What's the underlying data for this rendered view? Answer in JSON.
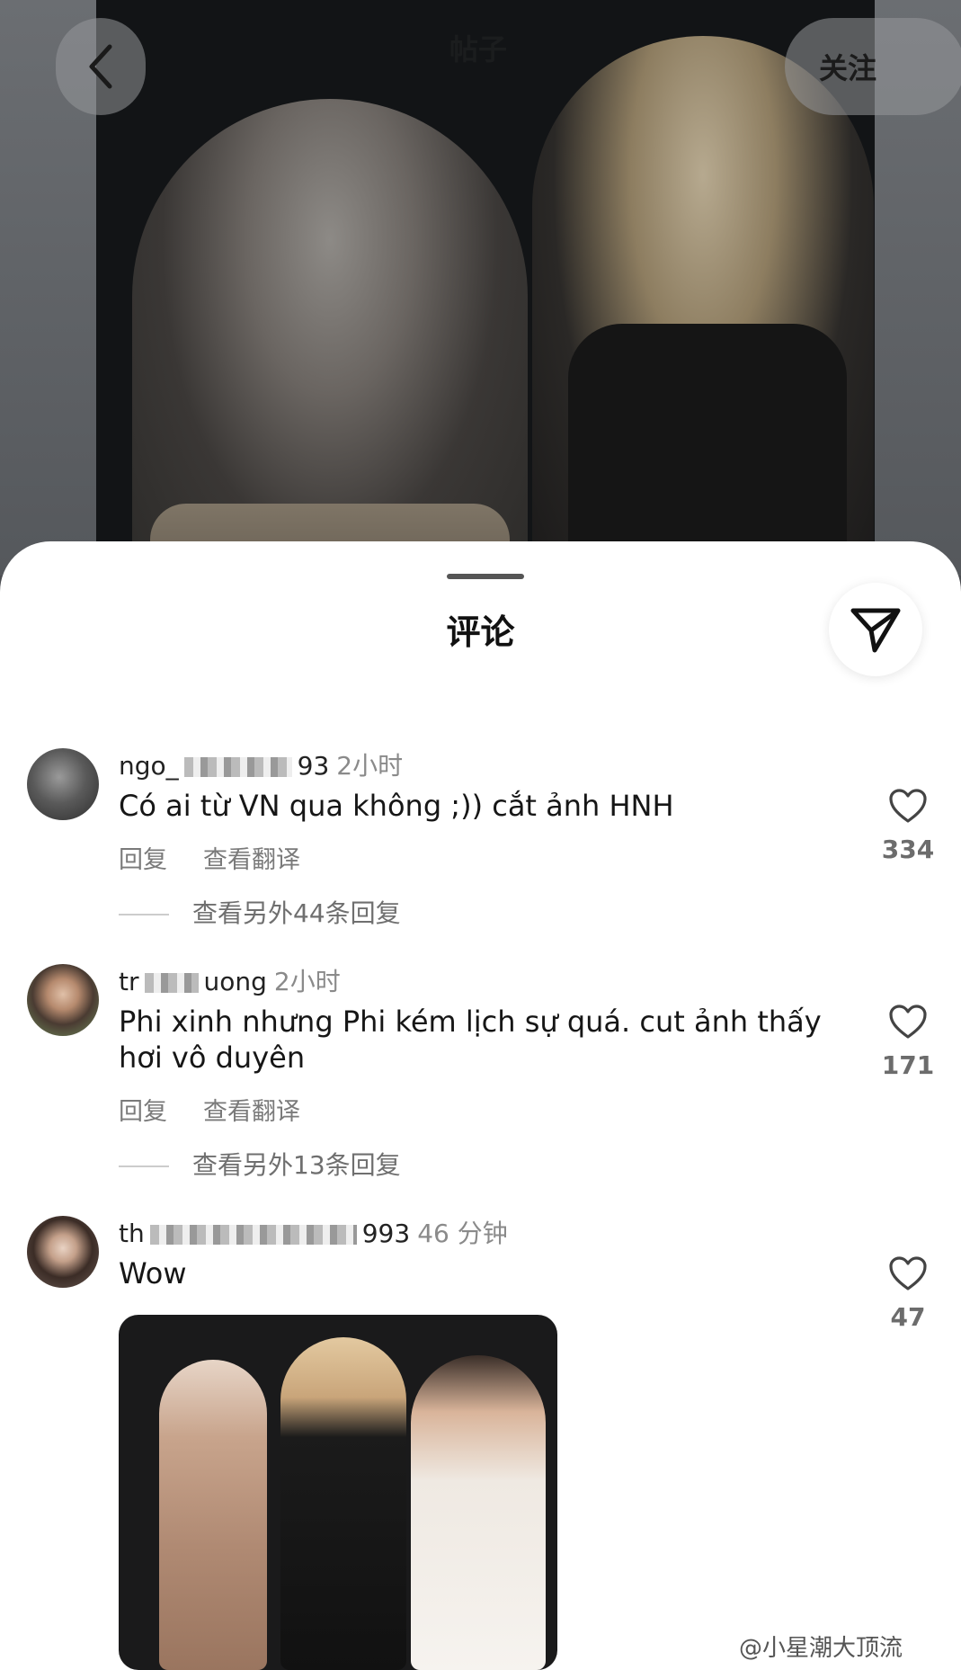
{
  "header": {
    "back_icon": "chevron-left-icon",
    "follow_label": "关注",
    "faint_title": "帖子"
  },
  "sheet": {
    "title": "评论",
    "share_icon": "send-icon"
  },
  "comments": [
    {
      "username_prefix": "ngo_",
      "username_suffix": "93",
      "time": "2小时",
      "text": "Có ai từ VN qua không ;)) cắt ảnh HNH",
      "reply_label": "回复",
      "translate_label": "查看翻译",
      "more_replies": "查看另外44条回复",
      "likes": "334"
    },
    {
      "username_prefix": "tr",
      "username_suffix": "uong",
      "time": "2小时",
      "text": "Phi xinh nhưng Phi kém lịch sự quá. cut ảnh thấy hơi vô duyên",
      "reply_label": "回复",
      "translate_label": "查看翻译",
      "more_replies": "查看另外13条回复",
      "likes": "171"
    },
    {
      "username_prefix": "th",
      "username_suffix": "993",
      "time": "46 分钟",
      "text": "Wow",
      "likes": "47"
    }
  ],
  "watermark": "@小星潮大顶流",
  "colors": {
    "sheet_bg": "#ffffff",
    "backdrop": "#4b4d51",
    "secondary_text": "#7a7a7a"
  }
}
